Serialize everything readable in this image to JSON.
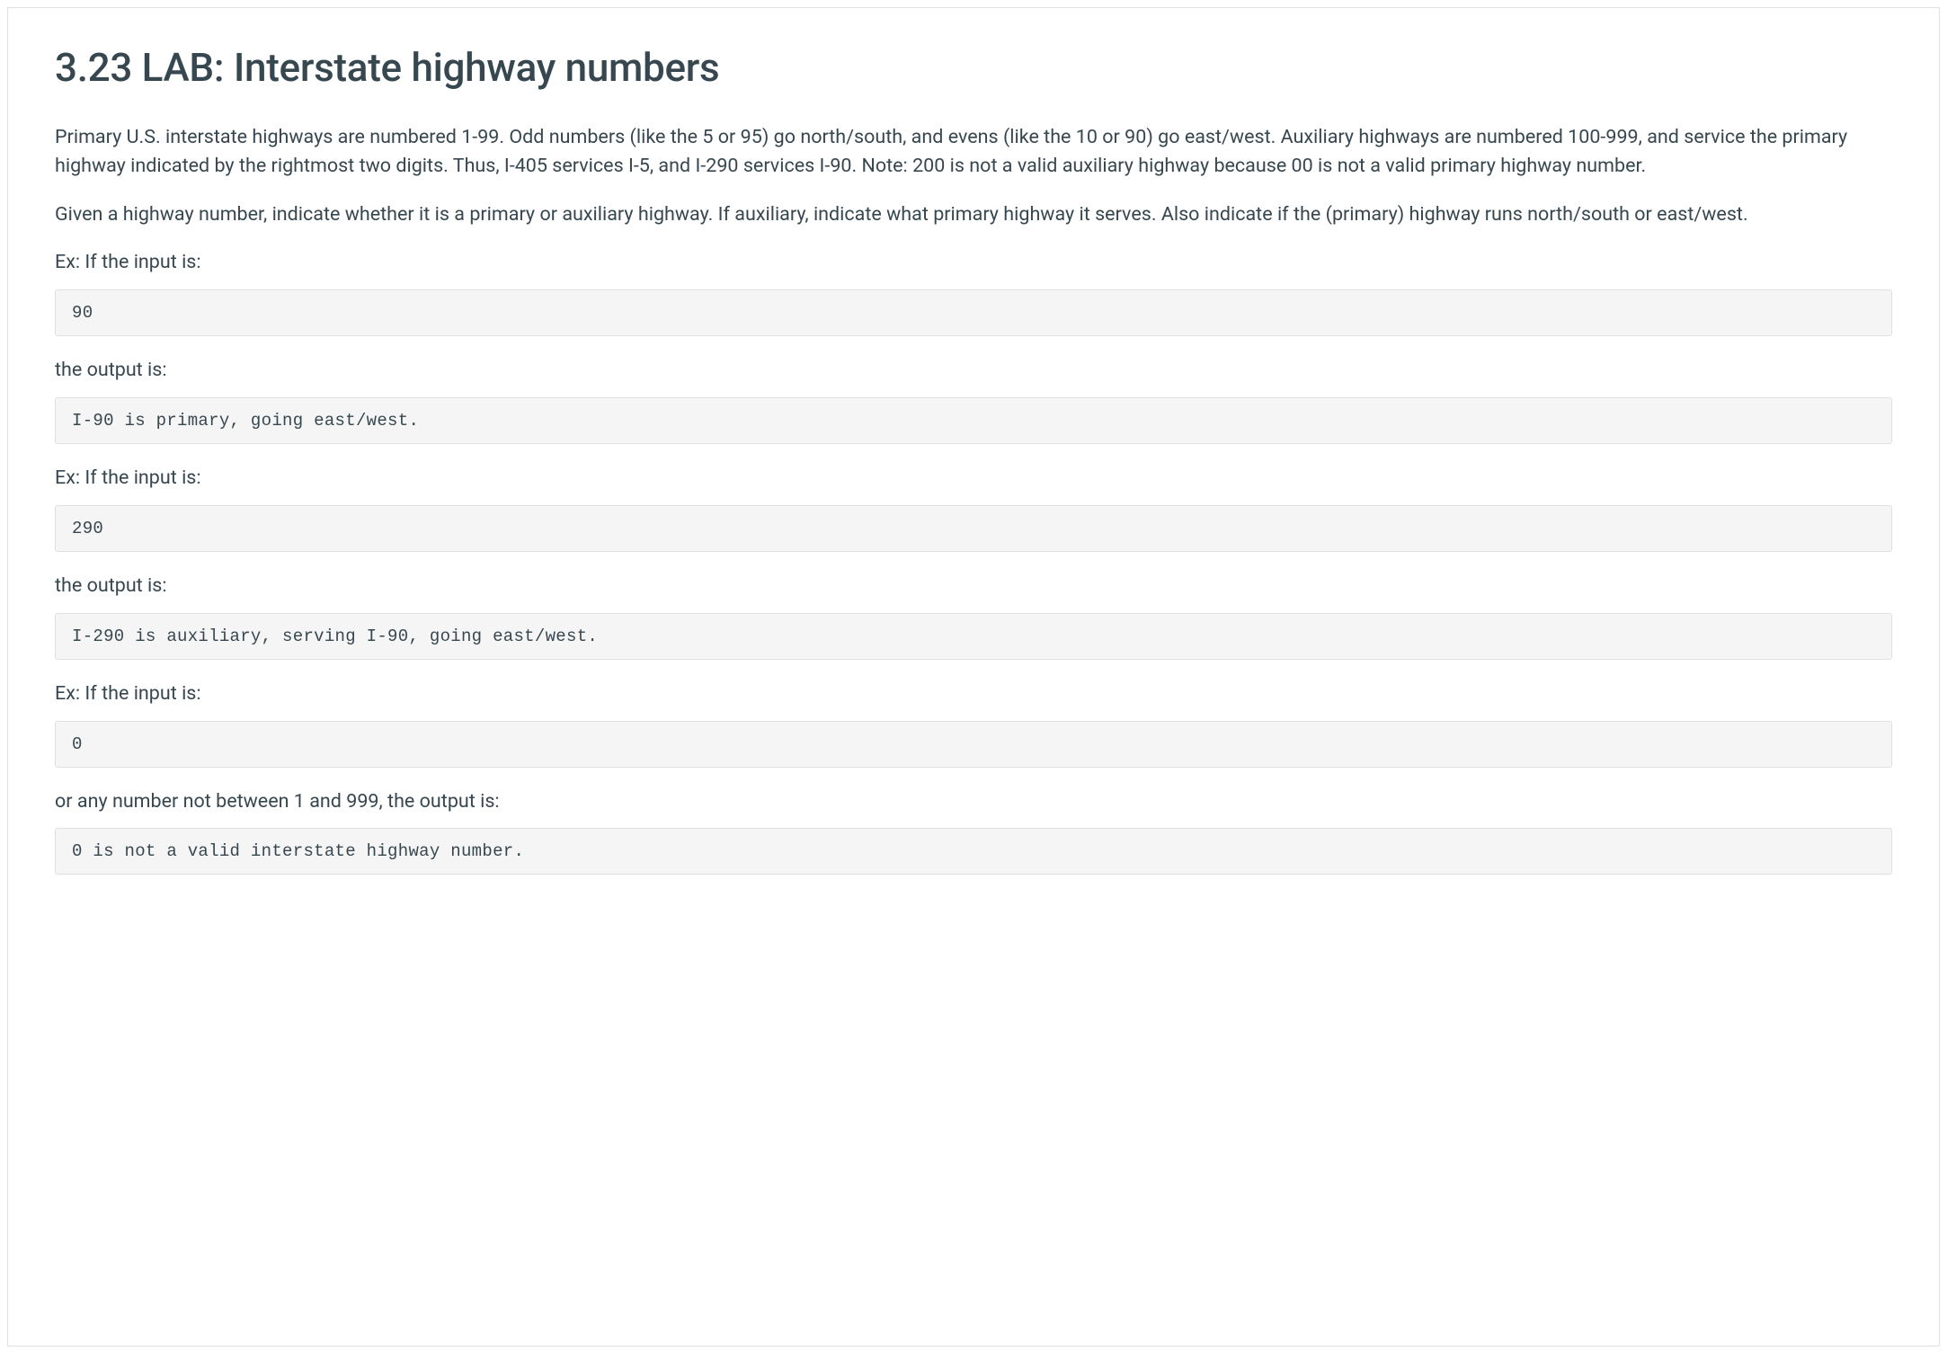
{
  "title": "3.23 LAB: Interstate highway numbers",
  "paragraphs": {
    "intro1": "Primary U.S. interstate highways are numbered 1-99. Odd numbers (like the 5 or 95) go north/south, and evens (like the 10 or 90) go east/west. Auxiliary highways are numbered 100-999, and service the primary highway indicated by the rightmost two digits. Thus, I-405 services I-5, and I-290 services I-90. Note: 200 is not a valid auxiliary highway because 00 is not a valid primary highway number.",
    "intro2": "Given a highway number, indicate whether it is a primary or auxiliary highway. If auxiliary, indicate what primary highway it serves. Also indicate if the (primary) highway runs north/south or east/west."
  },
  "examples": [
    {
      "input_label": "Ex: If the input is:",
      "input_code": "90",
      "output_label": "the output is:",
      "output_code": "I-90 is primary, going east/west."
    },
    {
      "input_label": "Ex: If the input is:",
      "input_code": "290",
      "output_label": "the output is:",
      "output_code": "I-290 is auxiliary, serving I-90, going east/west."
    },
    {
      "input_label": "Ex: If the input is:",
      "input_code": "0",
      "output_label": "or any number not between 1 and 999, the output is:",
      "output_code": "0 is not a valid interstate highway number."
    }
  ]
}
